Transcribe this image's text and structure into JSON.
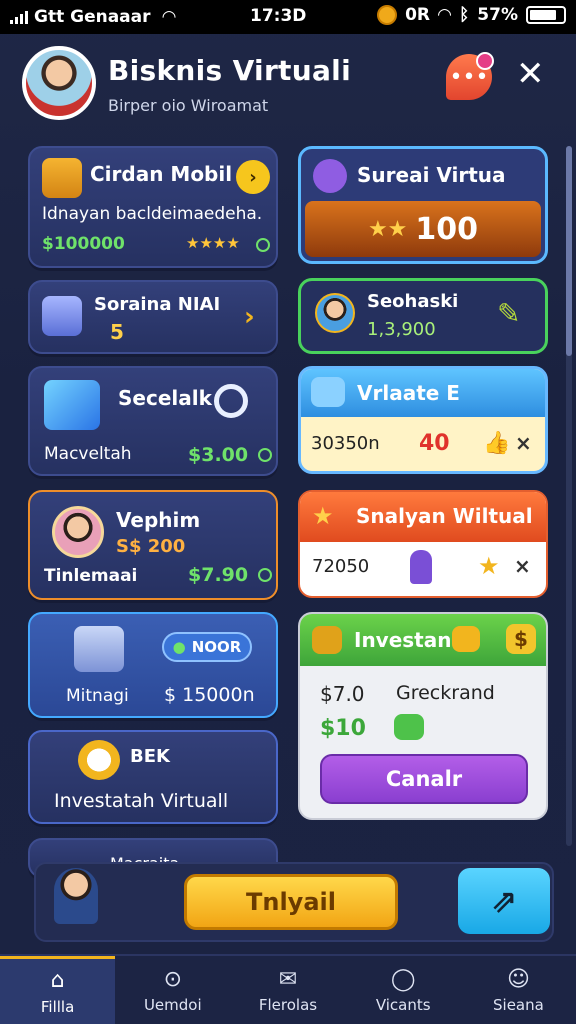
{
  "status": {
    "carrier": "Gtt Genaaar",
    "time": "17:3D",
    "carrier_right": "0R",
    "battery": "57%"
  },
  "header": {
    "title": "Bisknis Virtuali",
    "subtitle": "Birper oio Wiroamat"
  },
  "left": [
    {
      "title": "Cirdan Mobil",
      "desc": "Idnayan bacldeimaedeha.",
      "price": "$100000",
      "stars": "★★★★"
    },
    {
      "title": "Soraina NIAI",
      "value": "5"
    },
    {
      "title": "Secelalk",
      "label": "Macveltah",
      "price": "$3.00"
    },
    {
      "title": "Vephim",
      "sub": "S$ 200",
      "label": "Tinlemaai",
      "price": "$7.90"
    },
    {
      "badge": "NOOR",
      "label": "Mitnagi",
      "price": "$ 15000n"
    },
    {
      "title": "BEK",
      "label": "Investatah Virtuall"
    },
    {
      "title": "Macraita"
    }
  ],
  "right": [
    {
      "title": "Sureai Virtua",
      "value": "100",
      "stars": "★★"
    },
    {
      "title": "Seohaski",
      "value": "1,3,900"
    },
    {
      "title": "Vrlaate E",
      "value": "30350n",
      "label": "40",
      "mark": "×"
    },
    {
      "title": "Snalyan Wiltual",
      "value": "72050",
      "mark": "×"
    },
    {
      "title": "Investan",
      "price": "$7.0",
      "desc": "Greckrand",
      "price2": "$10",
      "button": "Canalr"
    }
  ],
  "bottom": {
    "cta": "Tnlyail"
  },
  "tabs": [
    {
      "label": "Fillla",
      "icon": "home-icon"
    },
    {
      "label": "Uemdoi",
      "icon": "compass-icon"
    },
    {
      "label": "Flerolas",
      "icon": "mail-icon"
    },
    {
      "label": "Vicants",
      "icon": "chat-icon"
    },
    {
      "label": "Sieana",
      "icon": "profile-icon"
    }
  ],
  "colors": {
    "accent": "#f2b51e",
    "green": "#6fe26a",
    "background": "#1f2746"
  }
}
